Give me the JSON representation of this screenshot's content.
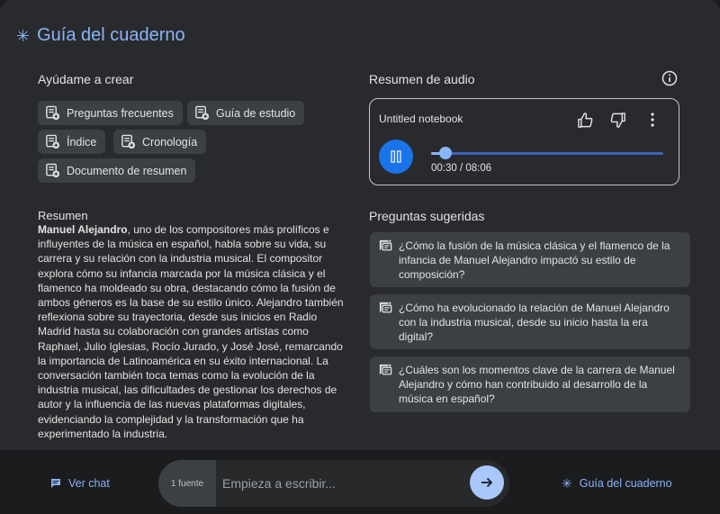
{
  "header": {
    "title": "Guía del cuaderno",
    "icon": "asterisk-icon"
  },
  "help": {
    "title": "Ayúdame a crear",
    "chips": [
      "Preguntas frecuentes",
      "Guía de estudio",
      "Índice",
      "Cronología",
      "Documento de resumen"
    ]
  },
  "summary": {
    "title": "Resumen",
    "lead": "Manuel Alejandro",
    "text": ", uno de los compositores más prolíficos e influyentes de la música en español, habla sobre su vida, su carrera y su relación con la industria musical. El compositor explora cómo su infancia marcada por la música clásica y el flamenco ha moldeado su obra, destacando cómo la fusión de ambos géneros es la base de su estilo único. Alejandro también reflexiona sobre su trayectoria, desde sus inicios en Radio Madrid hasta su colaboración con grandes artistas como Raphael, Julio Iglesias, Rocío Jurado, y José José, remarcando la importancia de Latinoamérica en su éxito internacional. La conversación también toca temas como la evolución de la industria musical, las dificultades de gestionar los derechos de autor y la influencia de las nuevas plataformas digitales, evidenciando la complejidad y la transformación que ha experimentado la industria."
  },
  "audio": {
    "title": "Resumen de audio",
    "notebook_name": "Untitled notebook",
    "time": "00:30 / 08:06",
    "progress": 0.062,
    "state": "playing"
  },
  "questions": {
    "title": "Preguntas sugeridas",
    "items": [
      "¿Cómo la fusión de la música clásica y el flamenco de la infancia de Manuel Alejandro impactó su estilo de composición?",
      "¿Cómo ha evolucionado la relación de Manuel Alejandro con la industria musical, desde su inicio hasta la era digital?",
      "¿Cuáles son los momentos clave de la carrera de Manuel Alejandro y cómo han contribuido al desarrollo de la música en español?"
    ]
  },
  "bottom": {
    "ver_chat": "Ver chat",
    "sources": "1 fuente",
    "placeholder": "Empieza a escribir...",
    "guide": "Guía del cuaderno"
  },
  "colors": {
    "accent": "#8ab4f8",
    "play": "#1a73e8",
    "send": "#a8c7fa",
    "chip": "#3c4043"
  }
}
